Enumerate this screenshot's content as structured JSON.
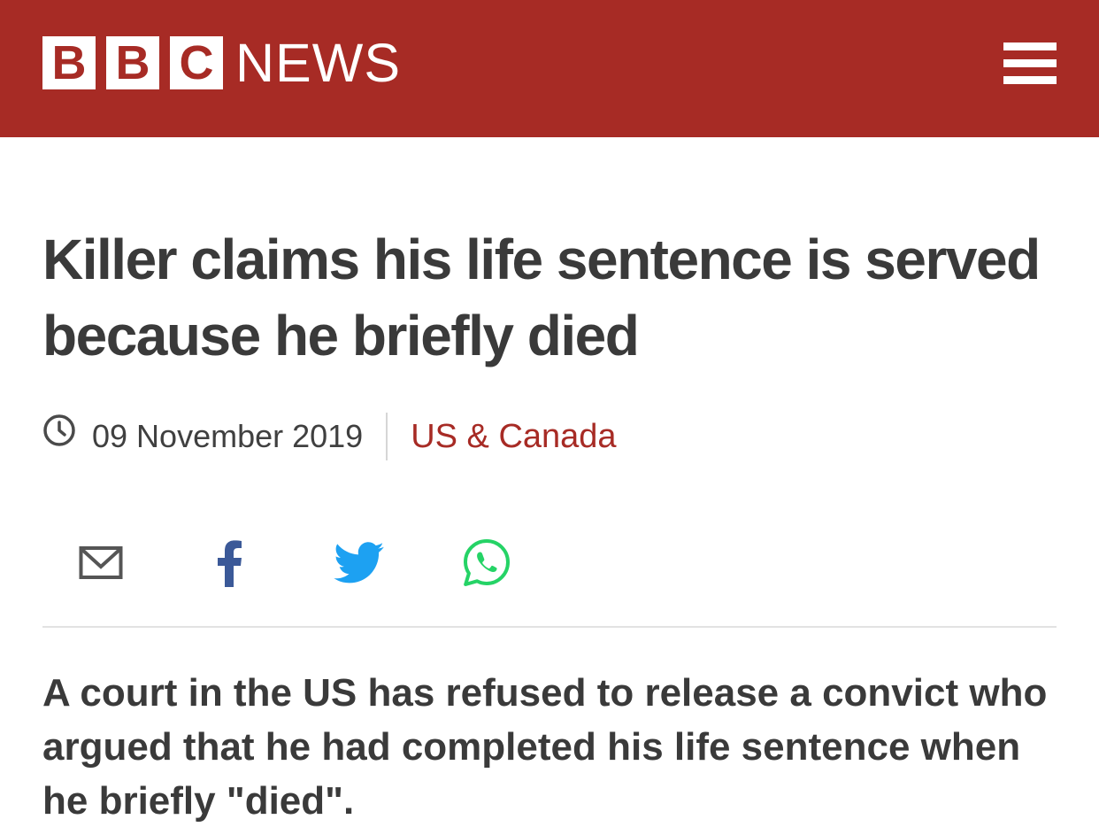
{
  "header": {
    "logo_letters": [
      "B",
      "B",
      "C"
    ],
    "logo_word": "NEWS",
    "brand_color": "#a72b25",
    "menu_icon": "hamburger-menu-icon"
  },
  "article": {
    "headline": "Killer claims his life sentence is served because he briefly died",
    "date": "09 November 2019",
    "section": "US & Canada",
    "share_icons": [
      "email-icon",
      "facebook-icon",
      "twitter-icon",
      "whatsapp-icon"
    ],
    "intro": "A court in the US has refused to release a convict who argued that he had completed his life sentence when he briefly \"died\"."
  }
}
